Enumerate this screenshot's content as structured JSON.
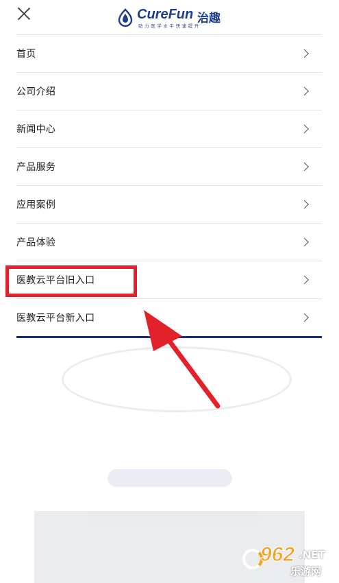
{
  "header": {
    "logo_text": "CureFun",
    "logo_cn": "治趣",
    "logo_tagline": "助力医学水平快速提升"
  },
  "menu": {
    "items": [
      {
        "label": "首页"
      },
      {
        "label": "公司介绍"
      },
      {
        "label": "新闻中心"
      },
      {
        "label": "产品服务"
      },
      {
        "label": "应用案例"
      },
      {
        "label": "产品体验"
      },
      {
        "label": "医教云平台旧入口"
      },
      {
        "label": "医教云平台新入口"
      }
    ],
    "highlighted_index": 6
  },
  "colors": {
    "brand": "#1e3c8f",
    "menu_underline": "#1a2d7a",
    "annotation": "#e2212a"
  },
  "watermark": {
    "number": "962",
    "suffix": ".NET",
    "cn": "乐游网"
  }
}
